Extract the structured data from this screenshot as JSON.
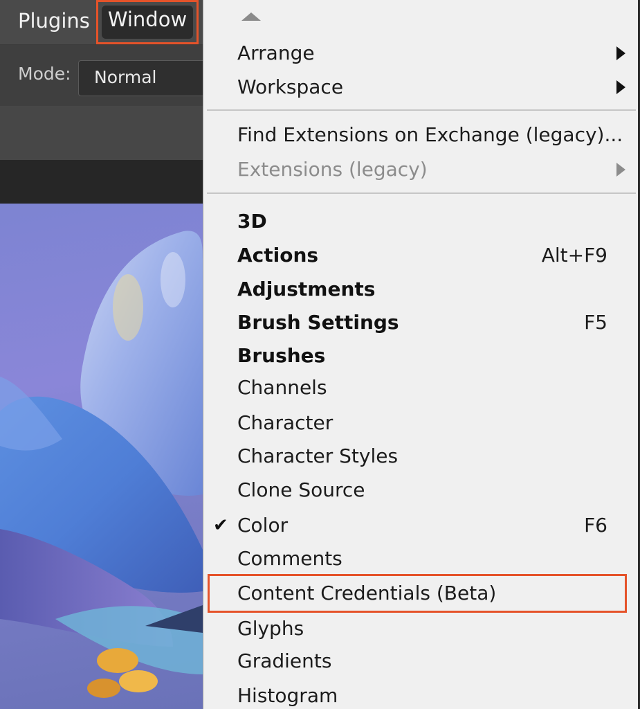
{
  "menubar": {
    "plugins_label": "Plugins",
    "window_label": "Window"
  },
  "options": {
    "mode_label": "Mode:",
    "mode_value": "Normal"
  },
  "menu": {
    "arrange": "Arrange",
    "workspace": "Workspace",
    "find_extensions": "Find Extensions on Exchange (legacy)...",
    "extensions": "Extensions (legacy)",
    "items": [
      {
        "label": "3D",
        "shortcut": ""
      },
      {
        "label": "Actions",
        "shortcut": "Alt+F9"
      },
      {
        "label": "Adjustments",
        "shortcut": ""
      },
      {
        "label": "Brush Settings",
        "shortcut": "F5"
      },
      {
        "label": "Brushes",
        "shortcut": ""
      },
      {
        "label": "Channels",
        "shortcut": ""
      },
      {
        "label": "Character",
        "shortcut": ""
      },
      {
        "label": "Character Styles",
        "shortcut": ""
      },
      {
        "label": "Clone Source",
        "shortcut": ""
      },
      {
        "label": "Color",
        "shortcut": "F6",
        "checked": true
      },
      {
        "label": "Comments",
        "shortcut": ""
      },
      {
        "label": "Content Credentials (Beta)",
        "shortcut": ""
      },
      {
        "label": "Glyphs",
        "shortcut": ""
      },
      {
        "label": "Gradients",
        "shortcut": ""
      },
      {
        "label": "Histogram",
        "shortcut": ""
      }
    ]
  },
  "colors": {
    "highlight": "#e5532a",
    "menu_bg": "#f0f0f0",
    "app_bg": "#4a4a4a"
  }
}
